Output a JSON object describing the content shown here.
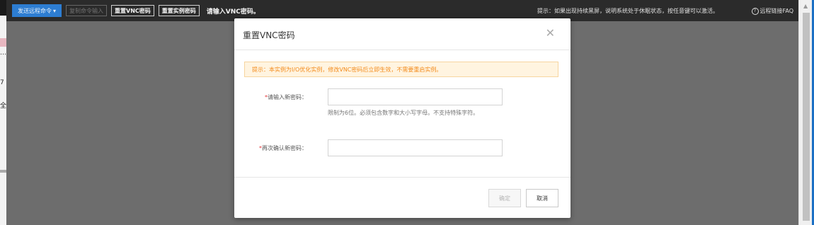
{
  "toolbar": {
    "send_command_label": "发送远程命令",
    "copy_input_label": "复制命令输入",
    "reset_vnc_label": "重置VNC密码",
    "reset_instance_label": "重置实例密码",
    "status_text": "请输入VNC密码。",
    "tip_text": "提示：如果出现持续黑屏，说明系统处于休眠状态，按任意键可以激活。",
    "faq_label": "远程链接FAQ",
    "faq_icon": "question-circle-icon"
  },
  "dialog": {
    "title": "重置VNC密码",
    "close_glyph": "✕",
    "notice": "提示：本实例为I/O优化实例，修改VNC密码后立即生效，不需要重启实例。",
    "new_password": {
      "required_mark": "*",
      "label": "请输入新密码：",
      "value": "",
      "hint": "限制为6位。必须包含数字和大小写字母。不支持特殊字符。"
    },
    "confirm_password": {
      "required_mark": "*",
      "label": "再次确认新密码：",
      "value": ""
    },
    "ok_label": "确定",
    "cancel_label": "取消"
  },
  "background": {
    "left_glyphs": [
      "…",
      "7",
      "全"
    ]
  },
  "colors": {
    "accent": "#2d7dd2",
    "notice_text": "#f38b1c",
    "notice_bg": "#fff4e0",
    "required": "#e4393c"
  }
}
